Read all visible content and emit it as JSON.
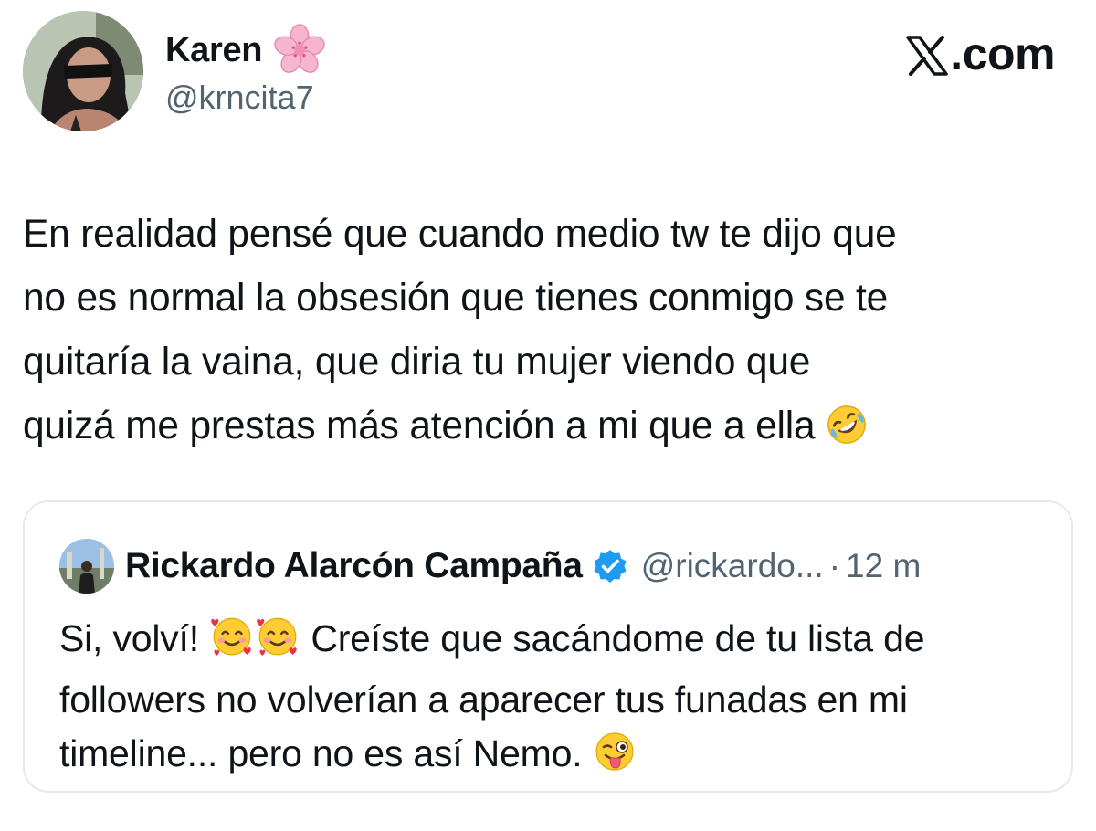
{
  "header": {
    "display_name": "Karen",
    "handle": "@krncita7",
    "brand": ".com"
  },
  "tweet": {
    "lines": [
      "En realidad pensé que cuando medio tw te dijo que",
      "no es normal la obsesión que tienes conmigo se te",
      "quitaría la vaina, que diria tu mujer viendo que",
      "quizá me prestas más atención a mi que a ella "
    ]
  },
  "quote": {
    "display_name": "Rickardo Alarcón Campaña",
    "handle": "@rickardo...",
    "separator": "·",
    "time": "12 m",
    "line1_start": "Si, volví! ",
    "line1_end": " Creíste que sacándome de tu lista de",
    "line2": "followers no volverían a aparecer tus funadas en mi",
    "line3": "timeline... pero no es así Nemo. "
  },
  "icons": {
    "name_emoji": "cherry-blossom-icon",
    "tweet_emoji": "rolling-on-floor-laughing-icon",
    "quote_emoji_1": "smiling-face-with-hearts-icon",
    "quote_emoji_2": "winking-face-with-tongue-icon",
    "verified": "verified-badge-icon",
    "brand_logo": "x-logo-icon"
  },
  "colors": {
    "text": "#0f1419",
    "secondary": "#536471",
    "verified": "#1d9bf0",
    "border": "#e6e9ec"
  }
}
